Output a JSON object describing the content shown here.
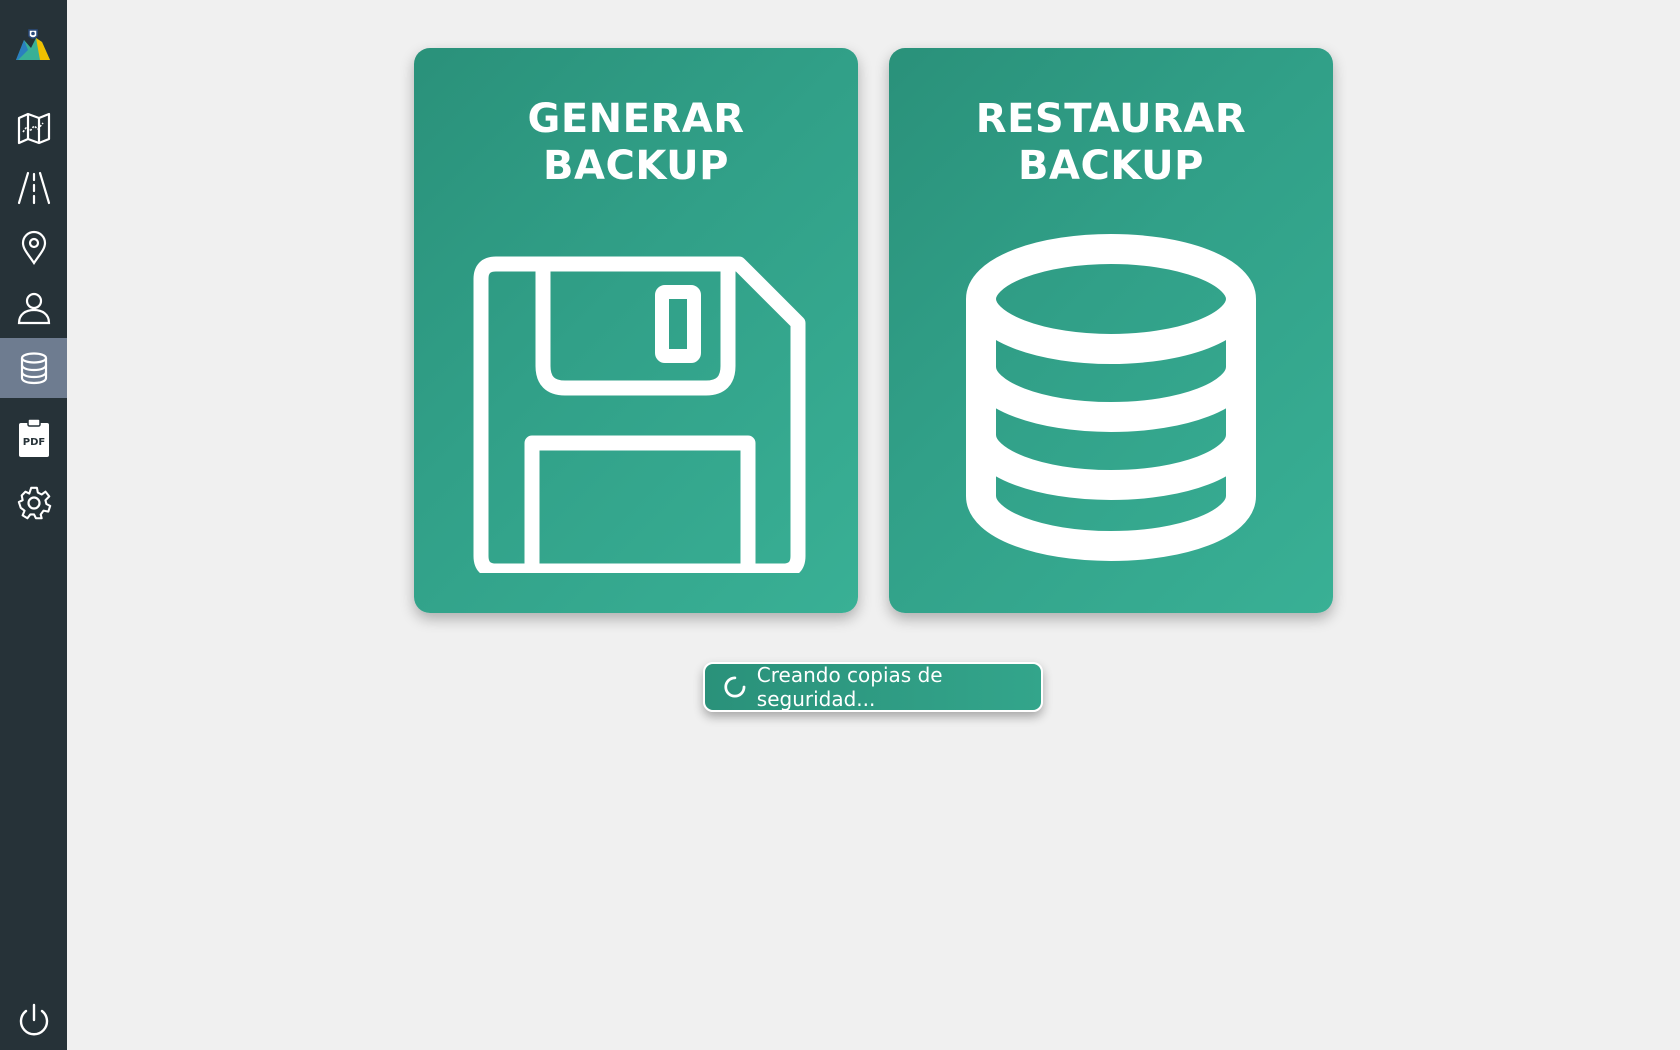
{
  "app": {
    "accent_color": "#31a088",
    "sidebar_color": "#263238",
    "active_item_color": "#6e7c90"
  },
  "sidebar": {
    "items": [
      {
        "icon": "map-icon",
        "active": false
      },
      {
        "icon": "road-icon",
        "active": false
      },
      {
        "icon": "location-pin-icon",
        "active": false
      },
      {
        "icon": "user-icon",
        "active": false
      },
      {
        "icon": "database-icon",
        "active": true
      },
      {
        "icon": "pdf-report-icon",
        "active": false,
        "icon_text": "PDF"
      },
      {
        "icon": "gear-icon",
        "active": false
      }
    ],
    "bottom_icon": "power-icon"
  },
  "cards": {
    "generate": {
      "title_line1": "GENERAR",
      "title_line2": "BACKUP",
      "icon": "floppy-disk-icon"
    },
    "restore": {
      "title_line1": "RESTAURAR",
      "title_line2": "BACKUP",
      "icon": "database-icon"
    }
  },
  "status": {
    "message": "Creando copias de seguridad...",
    "icon": "spinner-icon"
  }
}
